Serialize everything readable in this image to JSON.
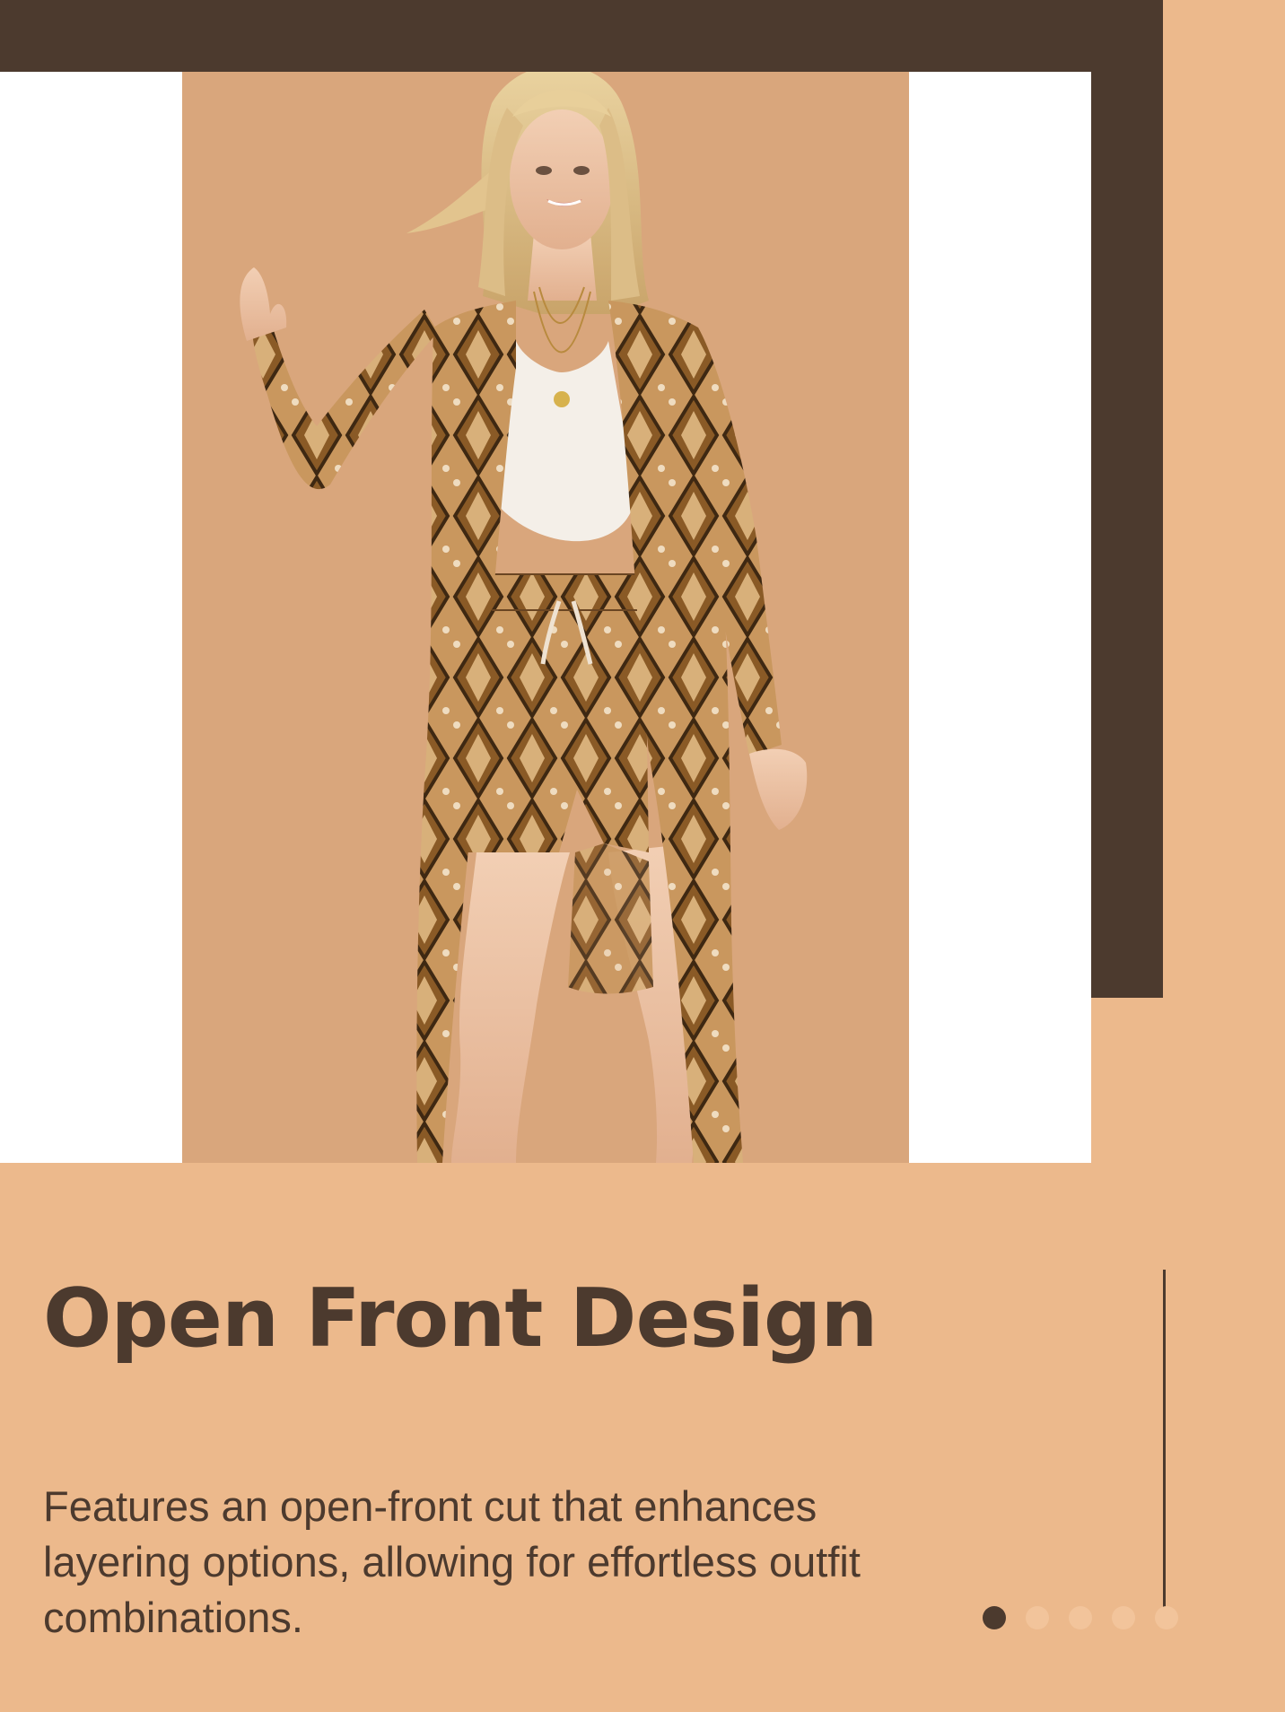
{
  "slide": {
    "title": "Open Front Design",
    "description": "Features an open-front cut that enhances layering options, allowing for effortless outfit combinations."
  },
  "carousel": {
    "total_slides": 5,
    "active_index": 0
  },
  "colors": {
    "background": "#ecb98c",
    "accent_dark": "#4c3a2e",
    "photo_backdrop": "#d9a67c",
    "panel": "#ffffff",
    "dot_inactive": "#f2c49b"
  }
}
